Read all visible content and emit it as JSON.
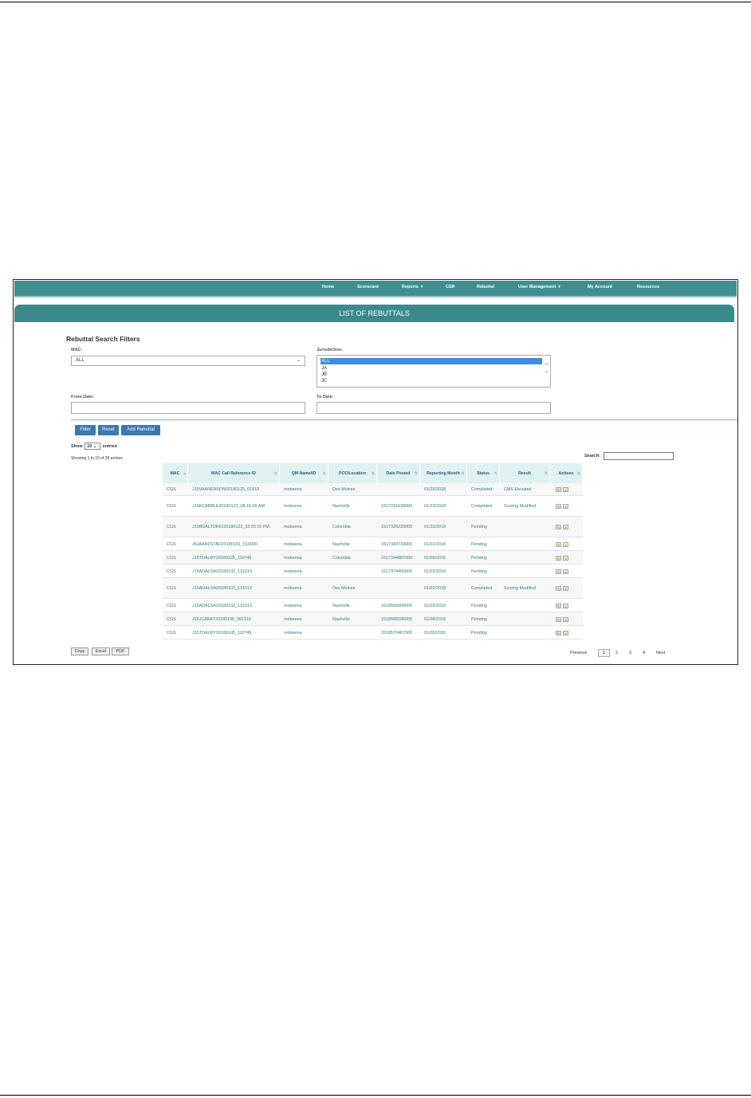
{
  "nav": {
    "home": "Home",
    "scorecard": "Scorecard",
    "reports": "Reports",
    "csr": "CSR",
    "rebuttal": "Rebuttal",
    "user_management": "User Management",
    "my_account": "My Account",
    "resources": "Resources",
    "dropdown_glyph": "▾"
  },
  "banner_title": "LIST OF REBUTTALS",
  "filters": {
    "title": "Rebuttal Search Filters",
    "mac_label": "MAC:",
    "mac_value": "ALL",
    "jurisdiction_label": "Jurisdiction:",
    "jurisdiction_options": [
      "ALL",
      "JA",
      "JB",
      "JC"
    ],
    "jurisdiction_selected": "ALL",
    "from_date_label": "From Date:",
    "to_date_label": "To Date:",
    "filter_btn": "Filter",
    "reset_btn": "Reset",
    "add_btn": "Add Rebuttal"
  },
  "table_controls": {
    "show_prefix": "Show",
    "show_value": "10",
    "show_suffix": "entries",
    "info": "Showing 1 to 10 of 38 entries",
    "search_label": "Search:"
  },
  "table": {
    "headers": [
      "MAC",
      "MAC Call Reference ID",
      "QM Name/ID",
      "PCC/Location",
      "Date Posted",
      "Reporting Month",
      "Status",
      "Result",
      "Actions"
    ],
    "rows": [
      {
        "mac": "CGS",
        "ref": "J15VAANENSON20180125_01519",
        "qm": "mobeena",
        "pcc": "Des Moines",
        "date": "",
        "month": "01/25/2018",
        "status": "Completed",
        "result": "CMS Elevated"
      },
      {
        "mac": "CGS",
        "ref": "J15KCABBLE20180123_08:15:00 AM",
        "qm": "mobeena",
        "pcc": "Nashville",
        "date": "1517231638000",
        "month": "01/23/2018",
        "status": "Completed",
        "result": "Scoring Modified"
      },
      {
        "mac": "CGS",
        "ref": "J15BDALTORIO20180123_03:20:19 PM",
        "qm": "mobeena",
        "pcc": "Columbia",
        "date": "1517329239000",
        "month": "01/23/2018",
        "status": "Pending",
        "result": ""
      },
      {
        "mac": "CGS",
        "ref": "J6JAARFSTAD20180101_010000",
        "qm": "mobeena",
        "pcc": "Nashville",
        "date": "1517343739000",
        "month": "01/01/2018",
        "status": "Pending",
        "result": ""
      },
      {
        "mac": "CGS",
        "ref": "J15TDALRY20180105_110749",
        "qm": "mobeena",
        "pcc": "Columbia",
        "date": "1517344887000",
        "month": "01/05/2018",
        "status": "Pending",
        "result": ""
      },
      {
        "mac": "CGS",
        "ref": "J15ADALSA20180102_131013",
        "qm": "mobeena",
        "pcc": "",
        "date": "1517374450000",
        "month": "01/02/2018",
        "status": "Pending",
        "result": ""
      },
      {
        "mac": "CGS",
        "ref": "J15ADALSA20180102_131013",
        "qm": "mobeena",
        "pcc": "Des Moines",
        "date": "",
        "month": "01/02/2018",
        "status": "Completed",
        "result": "Scoring Modified"
      },
      {
        "mac": "CGS",
        "ref": "J15ADALSA20180102_131013",
        "qm": "mobeena",
        "pcc": "Nashville",
        "date": "1518566909000",
        "month": "01/02/2018",
        "status": "Pending",
        "result": ""
      },
      {
        "mac": "CGS",
        "ref": "J15JCABAT20180108_081516",
        "qm": "mobeena",
        "pcc": "Nashville",
        "date": "1518568186000",
        "month": "01/08/2018",
        "status": "Pending",
        "result": ""
      },
      {
        "mac": "CGS",
        "ref": "J15TDALRY20180105_110749",
        "qm": "mobeena",
        "pcc": "",
        "date": "1518570467000",
        "month": "01/05/2018",
        "status": "Pending",
        "result": ""
      }
    ]
  },
  "export": {
    "copy": "Copy",
    "excel": "Excel",
    "pdf": "PDF"
  },
  "pagination": {
    "previous": "Previous",
    "pages": [
      "1",
      "2",
      "3",
      "4"
    ],
    "current": "1",
    "next": "Next"
  },
  "icons": {
    "edit": "edit-icon",
    "view": "view-icon",
    "sort": "sort-icon",
    "sort_glyph": "⇅",
    "sort_asc_glyph": "▴",
    "scroll_up": "⌃",
    "scroll_down": "⌄"
  }
}
